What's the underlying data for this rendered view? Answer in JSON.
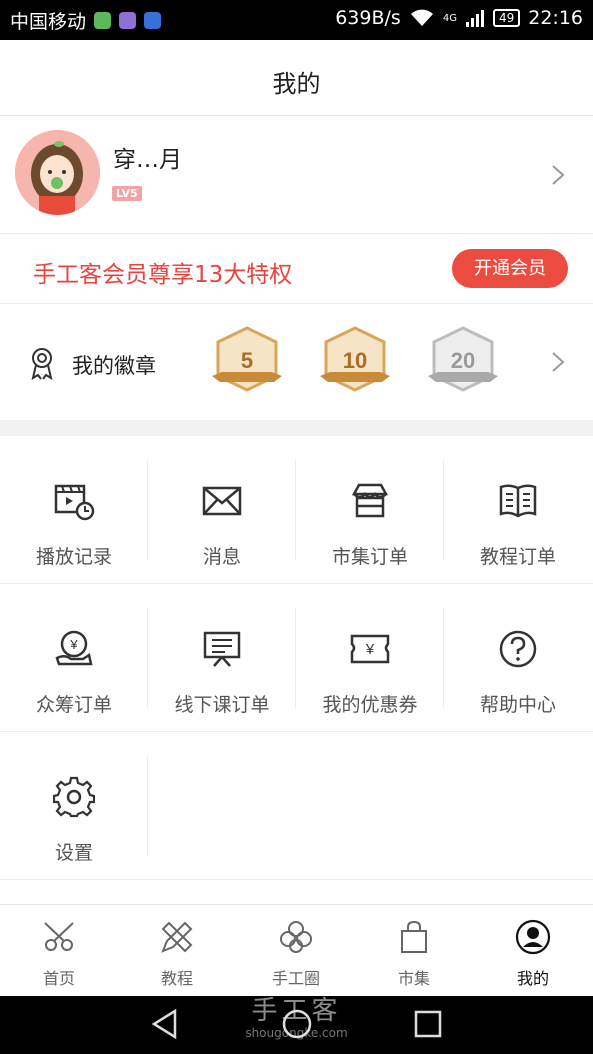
{
  "status_bar": {
    "carrier": "中国移动",
    "speed": "639B/s",
    "network": "4G",
    "battery": "49",
    "time": "22:16"
  },
  "header": {
    "title": "我的"
  },
  "profile": {
    "username": "穿…月",
    "level": "LV5"
  },
  "vip": {
    "text": "手工客会员尊享13大特权",
    "button": "开通会员"
  },
  "badges": {
    "label": "我的徽章",
    "medals": [
      "5",
      "10",
      "20"
    ]
  },
  "grid": [
    [
      {
        "label": "播放记录",
        "icon": "video-history-icon"
      },
      {
        "label": "消息",
        "icon": "envelope-icon"
      },
      {
        "label": "市集订单",
        "icon": "shop-icon"
      },
      {
        "label": "教程订单",
        "icon": "book-icon"
      }
    ],
    [
      {
        "label": "众筹订单",
        "icon": "crowdfund-icon"
      },
      {
        "label": "线下课订单",
        "icon": "presentation-icon"
      },
      {
        "label": "我的优惠券",
        "icon": "coupon-icon"
      },
      {
        "label": "帮助中心",
        "icon": "help-icon"
      }
    ],
    [
      {
        "label": "设置",
        "icon": "gear-icon"
      }
    ]
  ],
  "tabs": [
    {
      "label": "首页",
      "icon": "scissors-icon"
    },
    {
      "label": "教程",
      "icon": "pencil-ruler-icon"
    },
    {
      "label": "手工圈",
      "icon": "flower-icon"
    },
    {
      "label": "市集",
      "icon": "shopping-bag-icon"
    },
    {
      "label": "我的",
      "icon": "user-icon",
      "active": true
    }
  ],
  "watermark": {
    "text": "手工客",
    "url": "shougongke.com"
  },
  "colors": {
    "accent": "#ec4b3f",
    "vip_text": "#e8433f"
  }
}
